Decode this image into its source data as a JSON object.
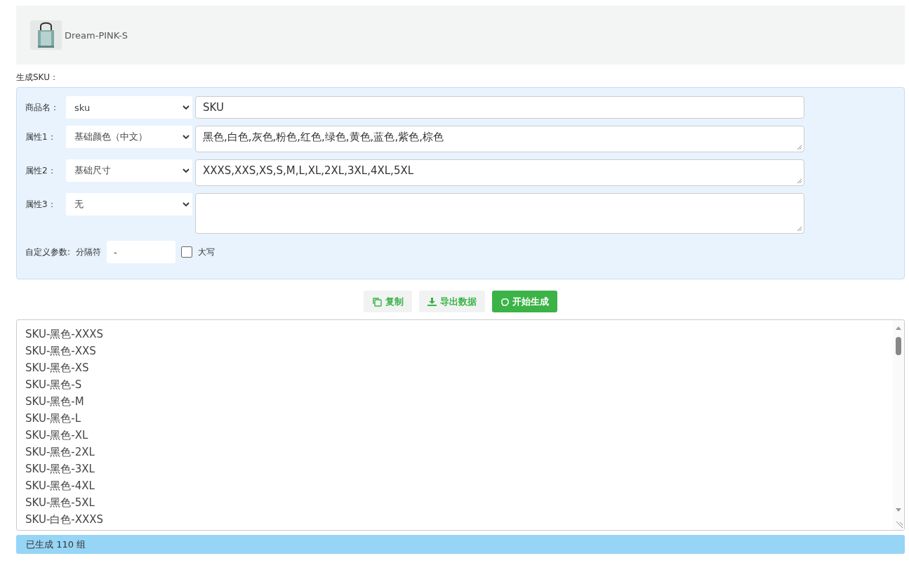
{
  "product": {
    "name": "Dream-PINK-S"
  },
  "section_label": "生成SKU：",
  "form": {
    "rows": [
      {
        "kind": "input",
        "label": "商品名：",
        "select": "sku",
        "value": "SKU"
      },
      {
        "kind": "textarea",
        "label": "属性1：",
        "select": "基础颜色（中文）",
        "value": "黑色,白色,灰色,粉色,红色,绿色,黄色,蓝色,紫色,棕色"
      },
      {
        "kind": "textarea",
        "label": "属性2：",
        "select": "基础尺寸",
        "value": "XXXS,XXS,XS,S,M,L,XL,2XL,3XL,4XL,5XL"
      },
      {
        "kind": "tall",
        "label": "属性3：",
        "select": "无"
      }
    ],
    "custom": {
      "label": "自定义参数:",
      "separator_label": "分隔符",
      "separator": "-",
      "uppercase": {
        "label": "大写",
        "checked": false
      }
    }
  },
  "buttons": [
    {
      "kind": "copy",
      "label": "复制",
      "primary": false
    },
    {
      "kind": "export",
      "label": "导出数据",
      "primary": false
    },
    {
      "kind": "start",
      "label": "开始生成",
      "primary": true
    }
  ],
  "output_lines": [
    "SKU-黑色-XXXS",
    "SKU-黑色-XXS",
    "SKU-黑色-XS",
    "SKU-黑色-S",
    "SKU-黑色-M",
    "SKU-黑色-L",
    "SKU-黑色-XL",
    "SKU-黑色-2XL",
    "SKU-黑色-3XL",
    "SKU-黑色-4XL",
    "SKU-黑色-5XL",
    "SKU-白色-XXXS"
  ],
  "status": "已生成 110 组"
}
